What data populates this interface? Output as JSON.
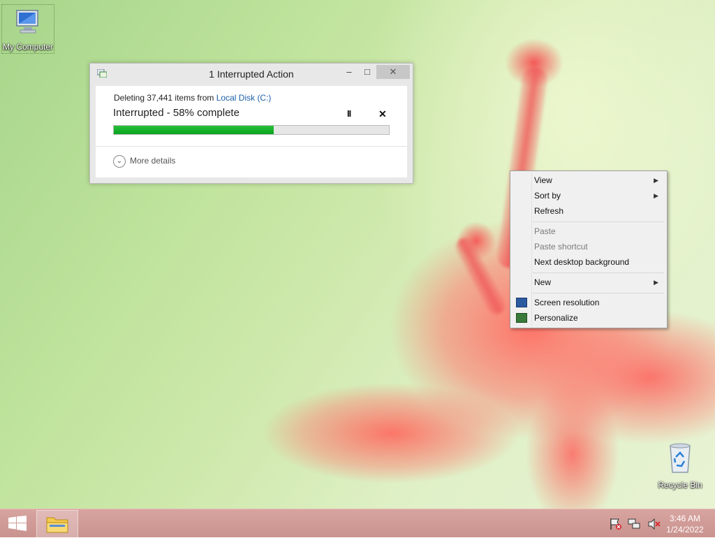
{
  "desktop": {
    "icons": [
      {
        "label": "My Computer"
      },
      {
        "label": "Recycle Bin"
      }
    ]
  },
  "window": {
    "title": "1 Interrupted Action",
    "min_glyph": "–",
    "max_glyph": "□",
    "close_glyph": "✕",
    "line1_prefix": "Deleting 37,441 items from ",
    "line1_link": "Local Disk (C:)",
    "status": "Interrupted - 58% complete",
    "progress": 0.58,
    "pause_glyph": "II",
    "stop_glyph": "✕",
    "more_details": "More details",
    "chevron_glyph": "⌄"
  },
  "context_menu": {
    "items": [
      {
        "label": "View",
        "submenu": true
      },
      {
        "label": "Sort by",
        "submenu": true
      },
      {
        "label": "Refresh"
      },
      {
        "label": "Paste",
        "disabled": true
      },
      {
        "label": "Paste shortcut",
        "disabled": true
      },
      {
        "label": "Next desktop background"
      },
      {
        "label": "New",
        "submenu": true
      },
      {
        "label": "Screen resolution",
        "icon": "display-icon"
      },
      {
        "label": "Personalize",
        "icon": "personalize-icon"
      }
    ],
    "arrow_glyph": "▶"
  },
  "taskbar": {
    "clock_time": "3:46 AM",
    "clock_date": "1/24/2022"
  },
  "colors": {
    "progress": "#0aa21f",
    "link": "#1a5fa8",
    "taskbar": "#c9938f"
  }
}
